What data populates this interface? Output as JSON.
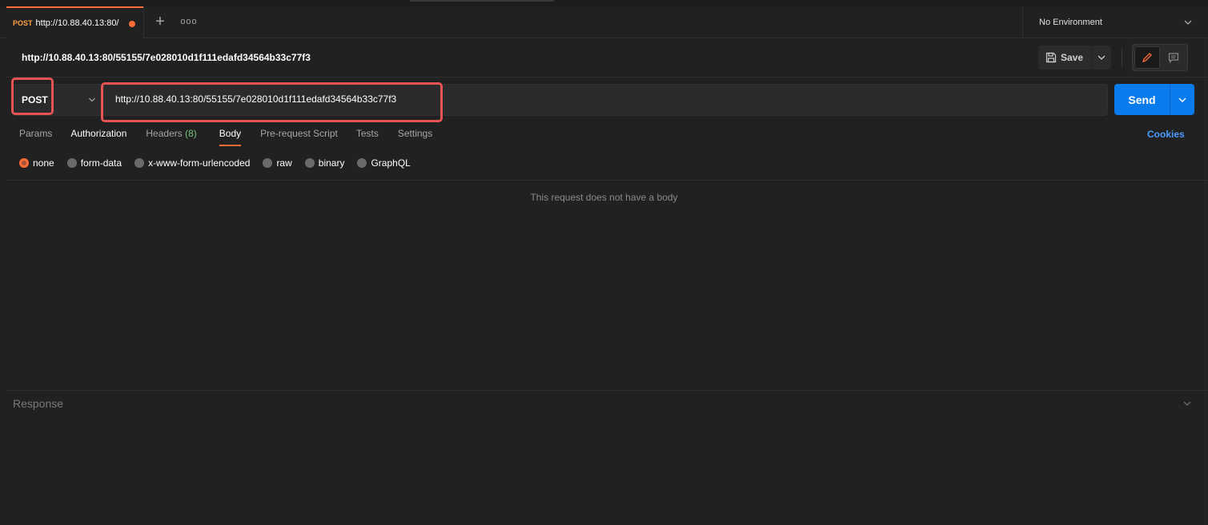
{
  "tab": {
    "method": "POST",
    "title": "http://10.88.40.13:80/"
  },
  "tabbar": {
    "new_tab": "+",
    "more": "ooo"
  },
  "environment": {
    "label": "No Environment"
  },
  "request": {
    "name": "http://10.88.40.13:80/55155/7e028010d1f111edafd34564b33c77f3",
    "method": "POST",
    "url": "http://10.88.40.13:80/55155/7e028010d1f111edafd34564b33c77f3"
  },
  "toolbar": {
    "save_label": "Save",
    "send_label": "Send"
  },
  "request_tabs": {
    "params": "Params",
    "authorization": "Authorization",
    "headers": "Headers",
    "headers_count": "(8)",
    "body": "Body",
    "prerequest": "Pre-request Script",
    "tests": "Tests",
    "settings": "Settings",
    "cookies": "Cookies"
  },
  "body_options": {
    "none": "none",
    "form_data": "form-data",
    "urlencoded": "x-www-form-urlencoded",
    "raw": "raw",
    "binary": "binary",
    "graphql": "GraphQL",
    "selected": "none"
  },
  "body_empty_message": "This request does not have a body",
  "response": {
    "label": "Response"
  },
  "colors": {
    "accent": "#ff6c37",
    "send": "#097bed",
    "highlight": "#e55353",
    "link": "#4c9bff"
  }
}
